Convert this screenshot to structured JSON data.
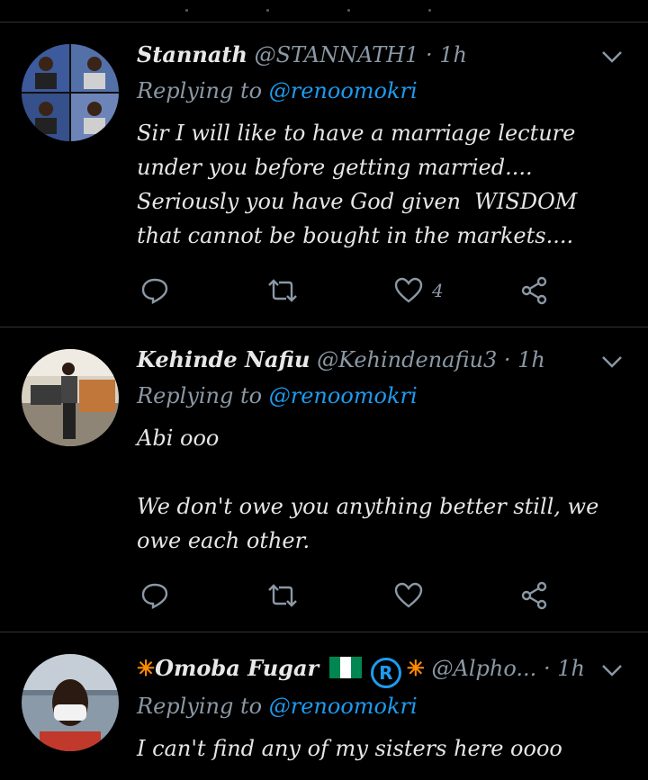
{
  "tweets": [
    {
      "name": "Stannath",
      "handle": "@STANNATH1",
      "dot": "·",
      "time": "1h",
      "replying_prefix": "Replying to",
      "replying_to": "@renoomokri",
      "body": "Sir I will like to have a marriage lecture under you before getting married.... Seriously you have God given  WISDOM that cannot be bought in the markets....",
      "like_count": "4"
    },
    {
      "name": "Kehinde Nafiu",
      "handle": "@Kehindenafiu3",
      "dot": "·",
      "time": "1h",
      "replying_prefix": "Replying to",
      "replying_to": "@renoomokri",
      "body": "Abi ooo\n\nWe don't owe you anything better still, we owe each other.",
      "like_count": ""
    },
    {
      "name_star_left": "✳",
      "name": "Omoba Fugar",
      "reg_mark": "R",
      "name_star_right": "✳",
      "handle": "@Alpho...",
      "dot": "·",
      "time": "1h",
      "replying_prefix": "Replying to",
      "replying_to": "@renoomokri",
      "body": "I can't find any of my sisters here oooo"
    }
  ],
  "colors": {
    "background": "#000000",
    "accent": "#1d9bf0",
    "muted": "#8b98a5",
    "divider": "#2f3336",
    "flag_green": "#008751",
    "star": "#ff8a00"
  },
  "icons": [
    "reply-icon",
    "retweet-icon",
    "like-icon",
    "share-icon",
    "chevron-down-icon",
    "nigeria-flag-icon",
    "registered-icon"
  ]
}
